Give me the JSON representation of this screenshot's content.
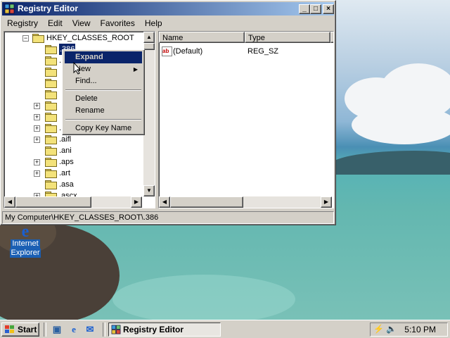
{
  "window": {
    "title": "Registry Editor",
    "minimize": "_",
    "maximize": "□",
    "close": "×"
  },
  "menu": [
    "Registry",
    "Edit",
    "View",
    "Favorites",
    "Help"
  ],
  "tree": {
    "root_label": "HKEY_CLASSES_ROOT",
    "selected_label": ".386",
    "items": [
      ".",
      "",
      "",
      "",
      "",
      "",
      "",
      ".",
      "",
      ".aifl",
      ".ani",
      ".aps",
      ".art",
      ".asa",
      ".ascx"
    ],
    "visible_labels": [
      ".aifl",
      ".ani",
      ".aps",
      ".art",
      ".asa",
      ".ascx"
    ]
  },
  "list": {
    "columns": [
      "Name",
      "Type",
      "D"
    ],
    "rows": [
      {
        "name": "(Default)",
        "type": "REG_SZ",
        "data": "v"
      }
    ]
  },
  "context_menu": {
    "items": [
      "Expand",
      "New",
      "Find...",
      "Delete",
      "Rename",
      "Copy Key Name"
    ],
    "highlighted": "Expand"
  },
  "status": "My Computer\\HKEY_CLASSES_ROOT\\.386",
  "desktop_icon": {
    "line1": "Internet",
    "line2": "Explorer"
  },
  "taskbar": {
    "start_label": "Start",
    "task_label": "Registry Editor",
    "clock": "5:10 PM"
  },
  "icons": [
    "registry-icon",
    "folder-icon",
    "string-value-icon",
    "ie-icon",
    "show-desktop-icon",
    "outlook-icon",
    "speaker-icon",
    "network-icon",
    "windows-logo-icon"
  ]
}
